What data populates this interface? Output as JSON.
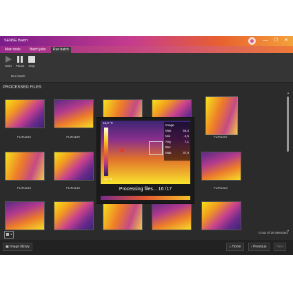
{
  "window": {
    "title": "SENSE Batch",
    "controls": {
      "minimize": "—",
      "maximize": "☐",
      "close": "✕"
    }
  },
  "tabs": [
    {
      "label": "Main tools"
    },
    {
      "label": "Batch jobs"
    },
    {
      "label": "Run batch"
    }
  ],
  "ribbon": {
    "buttons": [
      {
        "label": "Start",
        "icon": "play-icon"
      },
      {
        "label": "Pause",
        "icon": "pause-icon"
      },
      {
        "label": "Stop",
        "icon": "stop-icon"
      }
    ],
    "group_label": "Run batch"
  },
  "section": {
    "title": "PROCESSED FILES"
  },
  "images": [
    {
      "label": "FLIR1203"
    },
    {
      "label": "FLIR1199"
    },
    {
      "label": ""
    },
    {
      "label": ""
    },
    {
      "label": "FLIR1207"
    },
    {
      "label": "FLIR1213"
    },
    {
      "label": "FLIR1215"
    },
    {
      "label": "FLIR1223"
    }
  ],
  "dialog": {
    "temp_label": "16,0 °C",
    "scale_bottom": "-4,2 °C",
    "panel": {
      "title": "Image",
      "rows": [
        {
          "name": "Max",
          "value": "56,4"
        },
        {
          "name": "Min",
          "value": "-4,5"
        },
        {
          "name": "Avg",
          "value": "7,1"
        },
        {
          "name": "Bx1",
          "value": ""
        },
        {
          "name": "Max",
          "value": "37,0"
        }
      ]
    },
    "status": "Processing files... 16 /17"
  },
  "selection": {
    "text": "0 out of 16 selected"
  },
  "bottom": {
    "image_library": "Image library",
    "home": "Home",
    "previous": "Previous",
    "next": "Next"
  }
}
